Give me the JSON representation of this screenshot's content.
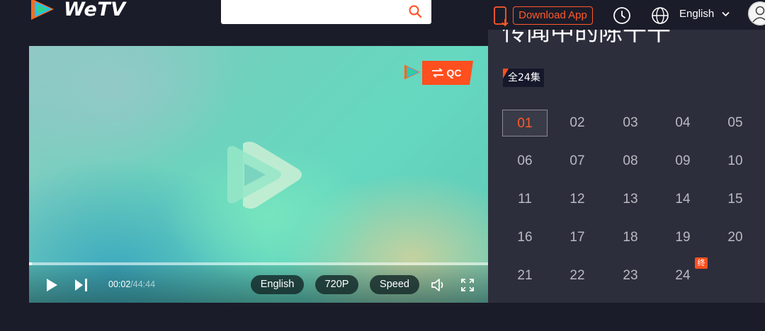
{
  "header": {
    "logo_text": "WeTV",
    "search": {
      "placeholder": ""
    },
    "download_label": "Download App",
    "language_label": "English",
    "icons": {
      "logo": "wetv-play-logo",
      "search": "search-icon",
      "download": "phone-download-icon",
      "history": "clock-icon",
      "language": "globe-icon",
      "language_menu": "chevron-down-icon",
      "account": "avatar-icon"
    },
    "colors": {
      "accent": "#ff5a2a",
      "background": "#1b1c29"
    }
  },
  "player": {
    "qc_label": "QC",
    "time_current": "00:02",
    "time_separator": "/",
    "time_total": "44:44",
    "progress": 0.001,
    "subtitle_label": "English",
    "quality_label": "720P",
    "speed_label": "Speed",
    "icons": {
      "play": "play-icon",
      "next": "next-episode-icon",
      "volume": "volume-icon",
      "fullscreen": "fullscreen-icon",
      "qc_swap": "swap-arrows-icon"
    }
  },
  "panel": {
    "title": "传闻中的陈千千",
    "episode_count": "全24集",
    "active_episode": "01",
    "final_tag": "终",
    "episodes": [
      "01",
      "02",
      "03",
      "04",
      "05",
      "06",
      "07",
      "08",
      "09",
      "10",
      "11",
      "12",
      "13",
      "14",
      "15",
      "16",
      "17",
      "18",
      "19",
      "20",
      "21",
      "22",
      "23",
      "24"
    ]
  }
}
